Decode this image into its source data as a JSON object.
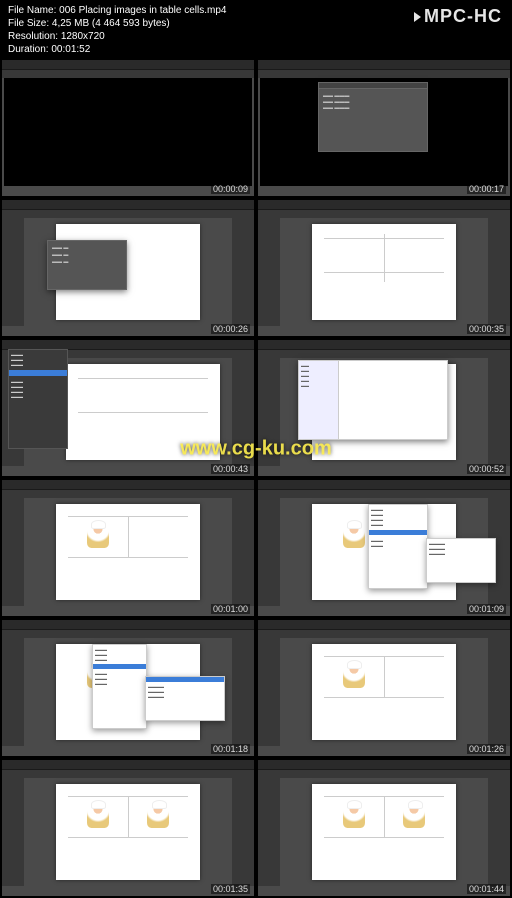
{
  "header": {
    "filename_label": "File Name:",
    "filename": "006 Placing images in table cells.mp4",
    "filesize_label": "File Size:",
    "filesize": "4,25 MB (4 464 593 bytes)",
    "resolution_label": "Resolution:",
    "resolution": "1280x720",
    "duration_label": "Duration:",
    "duration": "00:01:52"
  },
  "player": "MPC-HC",
  "watermark": "www.cg-ku.com",
  "thumbs": [
    {
      "ts": "00:00:09"
    },
    {
      "ts": "00:00:17"
    },
    {
      "ts": "00:00:26"
    },
    {
      "ts": "00:00:35"
    },
    {
      "ts": "00:00:43"
    },
    {
      "ts": "00:00:52"
    },
    {
      "ts": "00:01:00"
    },
    {
      "ts": "00:01:09"
    },
    {
      "ts": "00:01:18"
    },
    {
      "ts": "00:01:26"
    },
    {
      "ts": "00:01:35"
    },
    {
      "ts": "00:01:44"
    }
  ]
}
